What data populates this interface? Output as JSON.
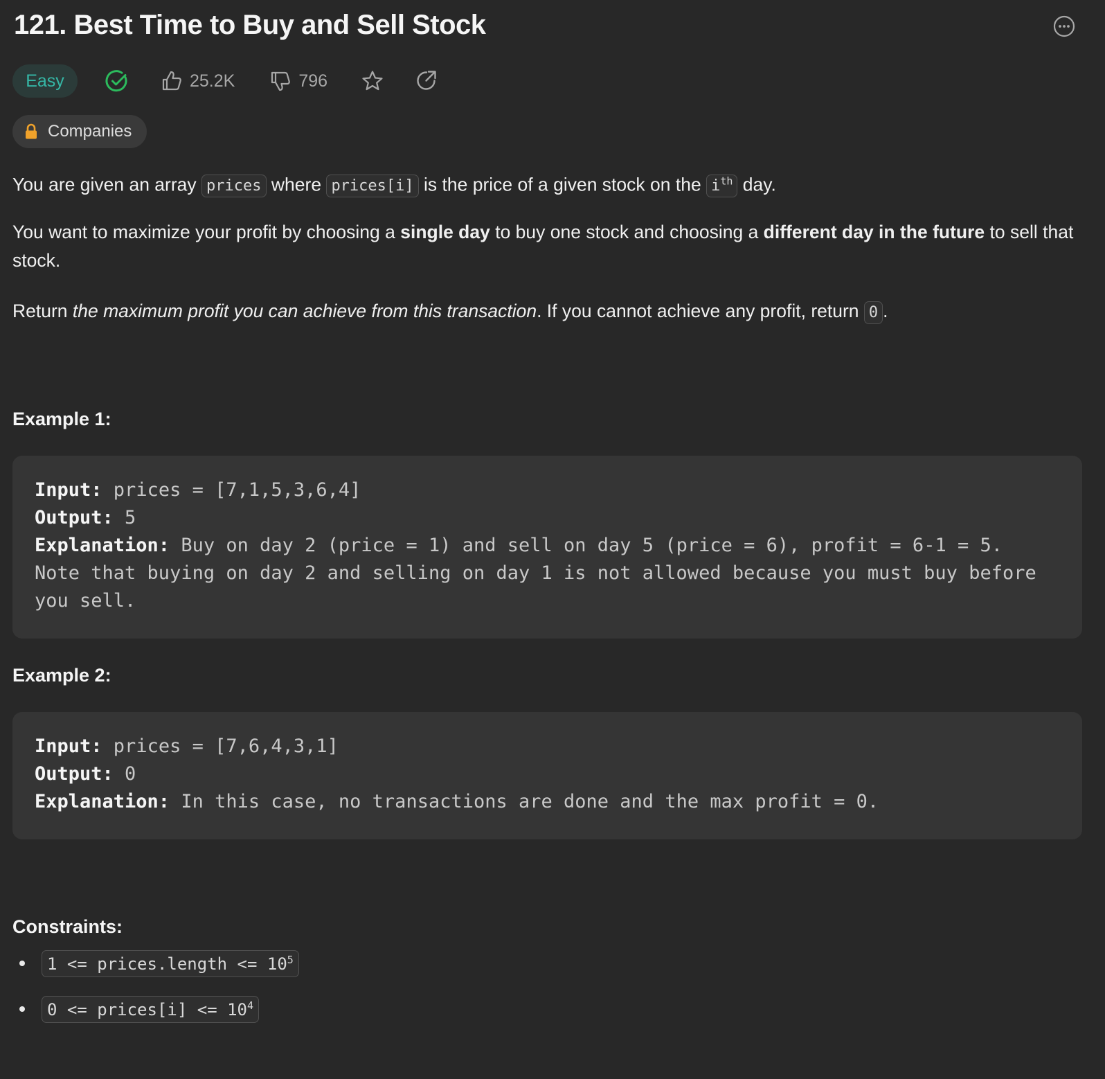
{
  "problem": {
    "title": "121. Best Time to Buy and Sell Stock",
    "difficulty": "Easy",
    "likes": "25.2K",
    "dislikes": "796",
    "companies_label": "Companies"
  },
  "description": {
    "p1": {
      "t1": "You are given an array ",
      "c1": "prices",
      "t2": " where ",
      "c2": "prices[i]",
      "t3": " is the price of a given stock on the ",
      "c3_base": "i",
      "c3_sup": "th",
      "t4": " day."
    },
    "p2": {
      "t1": "You want to maximize your profit by choosing a ",
      "b1": "single day",
      "t2": " to buy one stock and choosing a ",
      "b2": "different day in the future",
      "t3": " to sell that stock."
    },
    "p3": {
      "t1": "Return ",
      "i1": "the maximum profit you can achieve from this transaction",
      "t2": ". If you cannot achieve any profit, return ",
      "c1": "0",
      "t3": "."
    }
  },
  "examples": [
    {
      "heading": "Example 1:",
      "input_label": "Input:",
      "input": " prices = [7,1,5,3,6,4]",
      "output_label": "Output:",
      "output": " 5",
      "explanation_label": "Explanation:",
      "explanation": " Buy on day 2 (price = 1) and sell on day 5 (price = 6), profit = 6-1 = 5.\nNote that buying on day 2 and selling on day 1 is not allowed because you must buy before you sell."
    },
    {
      "heading": "Example 2:",
      "input_label": "Input:",
      "input": " prices = [7,6,4,3,1]",
      "output_label": "Output:",
      "output": " 0",
      "explanation_label": "Explanation:",
      "explanation": " In this case, no transactions are done and the max profit = 0."
    }
  ],
  "constraints": {
    "heading": "Constraints:",
    "items": [
      {
        "text": "1 <= prices.length <= 10",
        "sup": "5"
      },
      {
        "text": "0 <= prices[i] <= 10",
        "sup": "4"
      }
    ]
  },
  "colors": {
    "background": "#282828",
    "easy": "#35b7a6",
    "solved": "#2cbb5d",
    "lock": "#f0a22b"
  },
  "icons": [
    "more-options-icon",
    "solved-check-icon",
    "thumbs-up-icon",
    "thumbs-down-icon",
    "star-icon",
    "share-icon",
    "lock-icon"
  ]
}
